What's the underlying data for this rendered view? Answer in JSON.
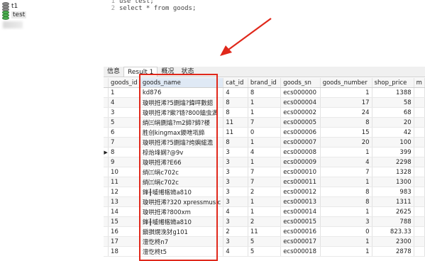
{
  "tree": {
    "databases": [
      {
        "label": "t1",
        "color": "gray"
      },
      {
        "label": "test",
        "color": "green",
        "selected": true
      }
    ]
  },
  "editor": {
    "lines": [
      {
        "num": "1",
        "code": "use test;"
      },
      {
        "num": "2",
        "code": "select * from goods;"
      }
    ]
  },
  "tabs": [
    "信息",
    "Result 1",
    "概况",
    "状态"
  ],
  "grid": {
    "columns": [
      "goods_id",
      "goods_name",
      "cat_id",
      "brand_id",
      "goods_sn",
      "goods_number",
      "shop_price",
      "m"
    ],
    "rows": [
      [
        "1",
        "kd876",
        "4",
        "8",
        "ecs000000",
        "1",
        "1388"
      ],
      [
        "4",
        "璇哄拰浠?5鍘熻?鍏呯數鍣",
        "8",
        "1",
        "ecs000004",
        "17",
        "58"
      ],
      [
        "3",
        "璇哄拰浠?鏉?钖?800鑰虫満",
        "8",
        "1",
        "ecs000002",
        "24",
        "68"
      ],
      [
        "5",
        "绱㈢埍鍘熻?m2鍗?鍗?楼",
        "11",
        "7",
        "ecs000005",
        "8",
        "20"
      ],
      [
        "6",
        "胜创kingmax鍐呭瓨鍗",
        "11",
        "0",
        "ecs000006",
        "15",
        "42"
      ],
      [
        "7",
        "璇哄拰浠?5鍘熻?绔嬩綋澹",
        "8",
        "1",
        "ecs000007",
        "20",
        "100"
      ],
      [
        "8",
        "椋炲埄娴?@9v",
        "3",
        "4",
        "ecs000008",
        "1",
        "399"
      ],
      [
        "9",
        "璇哄拰浠?E66",
        "3",
        "1",
        "ecs000009",
        "4",
        "2298"
      ],
      [
        "10",
        "绱㈢埍c702c",
        "3",
        "7",
        "ecs000010",
        "7",
        "1328"
      ],
      [
        "11",
        "绱㈢埍c702c",
        "3",
        "7",
        "ecs000011",
        "1",
        "1300"
      ],
      [
        "12",
        "鎽╂墭缃楁媺a810",
        "3",
        "2",
        "ecs000012",
        "8",
        "983"
      ],
      [
        "13",
        "璇哄拰浠?320 xpressmusic",
        "3",
        "1",
        "ecs000013",
        "8",
        "1311"
      ],
      [
        "14",
        "璇哄拰浠?800xm",
        "4",
        "1",
        "ecs000014",
        "1",
        "2625"
      ],
      [
        "15",
        "鎽╂墭缃楁媺a810",
        "3",
        "2",
        "ecs000015",
        "3",
        "788"
      ],
      [
        "16",
        "鎭掑熀浼犲g101",
        "2",
        "11",
        "ecs000016",
        "0",
        "823.33"
      ],
      [
        "17",
        "澶忔柊n7",
        "3",
        "5",
        "ecs000017",
        "1",
        "2300"
      ],
      [
        "18",
        "澶忔柊t5",
        "4",
        "5",
        "ecs000018",
        "1",
        "2878"
      ]
    ],
    "current_row_index": 6
  },
  "colors": {
    "annotation": "#e0281b",
    "selected_db": "#4caf50",
    "selected_header": "#dfe9f5"
  }
}
